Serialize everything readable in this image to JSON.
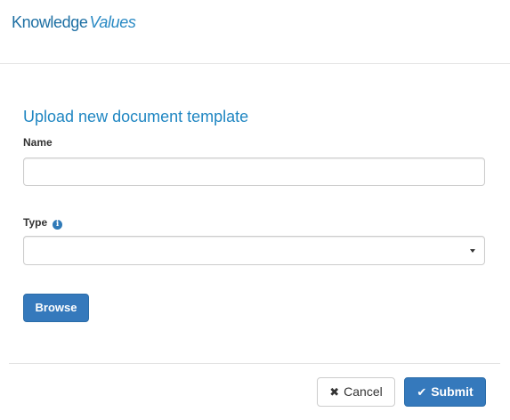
{
  "header": {
    "logo_primary": "Knowledge",
    "logo_secondary": "Values"
  },
  "form": {
    "title": "Upload new document template",
    "name_field": {
      "label": "Name",
      "value": "",
      "placeholder": ""
    },
    "type_field": {
      "label": "Type",
      "info_icon": "info-circle-icon",
      "selected_value": ""
    },
    "browse_label": "Browse"
  },
  "footer": {
    "cancel_label": "Cancel",
    "cancel_icon": "close-icon",
    "submit_label": "Submit",
    "submit_icon": "check-icon"
  },
  "colors": {
    "brand_blue": "#1d6fa3",
    "title_blue": "#1f86c2",
    "primary_button": "#3579bc"
  }
}
